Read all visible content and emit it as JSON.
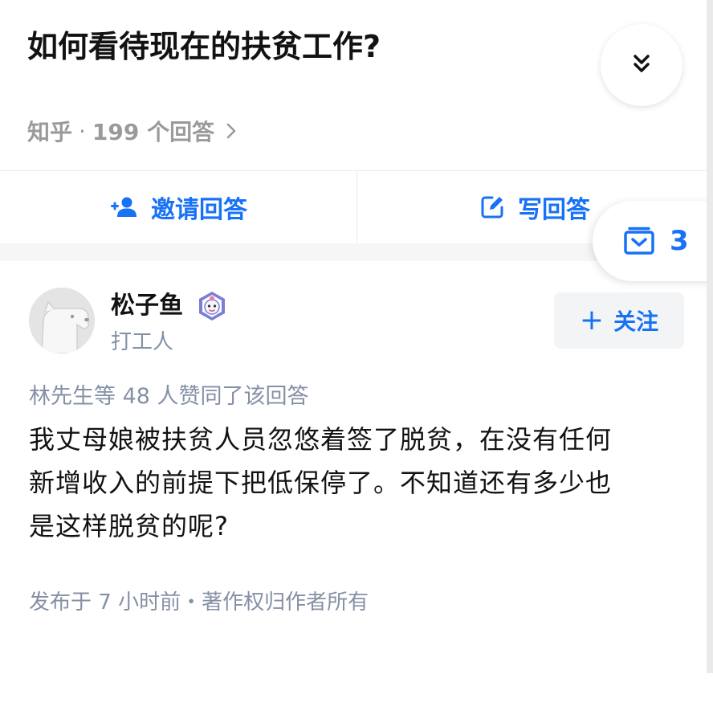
{
  "question": {
    "title": "如何看待现在的扶贫工作?",
    "source": "知乎",
    "separator": "·",
    "answer_count": "199 个回答"
  },
  "actions": {
    "invite_label": "邀请回答",
    "write_label": "写回答"
  },
  "favorites": {
    "count": "3"
  },
  "author": {
    "name": "松子鱼",
    "headline": "打工人",
    "follow_label": "关注",
    "follow_plus": "+"
  },
  "answer": {
    "voters": "林先生等 48 人赞同了该回答",
    "lines": [
      "我丈母娘被扶贫人员忽悠着签了脱贫，在没有任何",
      "新增收入的前提下把低保停了。不知道还有多少也",
      "是这样脱贫的呢?"
    ],
    "publish_info": "发布于 7 小时前・著作权归作者所有"
  },
  "colors": {
    "accent": "#1772f6",
    "secondary_text": "#8590a6",
    "primary_text": "#121212",
    "button_bg": "#f3f4f6"
  },
  "icons": {
    "collapse": "double-chevron-down-icon",
    "more": "chevron-right-icon",
    "invite": "add-person-icon",
    "write": "edit-icon",
    "favorites": "collection-box-icon",
    "badge": "creator-badge-icon"
  }
}
